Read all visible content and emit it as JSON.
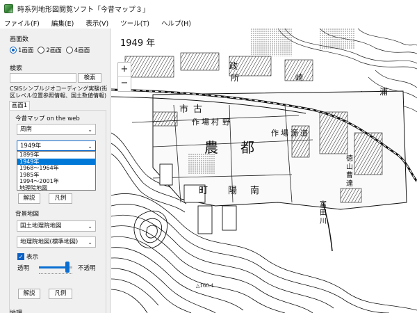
{
  "window": {
    "title": "時系列地形図閲覧ソフト「今昔マップ３」"
  },
  "menu": [
    "ファイル(F)",
    "編集(E)",
    "表示(V)",
    "ツール(T)",
    "ヘルプ(H)"
  ],
  "panel": {
    "screen_count": {
      "title": "画面数",
      "options": [
        "1画面",
        "2画面",
        "4画面"
      ],
      "selected": "1画面"
    },
    "search": {
      "title": "検索",
      "value": "",
      "button": "検索",
      "note": "CSISシンプルジオコーディング実験(街区レベル位置参照情報、国土数値情報)"
    },
    "tab": "画面1",
    "konjaku": {
      "title": "今昔マップ on the web",
      "region": "周南",
      "era": "1949年",
      "era_options": [
        "1899年",
        "1949年",
        "1968～1964年",
        "1985年",
        "1994～2001年",
        "地理院地図"
      ],
      "era_selected_index": 1,
      "explain_button": "解説",
      "legend_button": "凡例"
    },
    "background": {
      "title": "背景地図",
      "source": "国土地理院地図",
      "layer": "地理院地図(標準地図)",
      "show_label": "表示",
      "show_checked": true,
      "opacity_left": "透明",
      "opacity_right": "不透明",
      "opacity": 0.85,
      "explain_button": "解説",
      "legend_button": "凡例"
    },
    "bottom_label": "地理"
  },
  "map": {
    "year_label": "1949 年",
    "zoom_in": "+",
    "zoom_out": "−",
    "labels": {
      "k1": "政",
      "k2": "所",
      "k3": "崎",
      "k4": "浦",
      "k5": "市",
      "k6": "古",
      "k7": "作",
      "k8": "場",
      "k9": "村",
      "k10": "野",
      "k11": "農",
      "k12": "都",
      "k13": "作",
      "k14": "場",
      "k15": "源",
      "k16": "道",
      "k17": "町",
      "k18": "陽",
      "k19": "南",
      "k20": "徳",
      "k21": "山",
      "k22": "曹",
      "k23": "達",
      "k24": "富",
      "k25": "田",
      "k26": "川",
      "k27": "△160.4"
    }
  },
  "colors": {
    "accent": "#0078d7",
    "panel_bg": "#f0f0f0"
  }
}
